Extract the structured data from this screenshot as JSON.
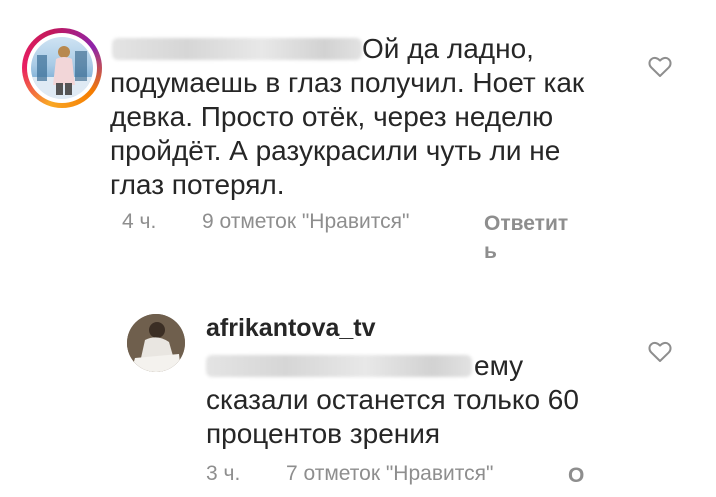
{
  "comments": [
    {
      "username_hidden": true,
      "text_lines": [
        "Ой да ладно,",
        "подумаешь в глаз получил. Ноет как",
        "девка. Просто отёк,  через неделю",
        "пройдёт. А разукрасили чуть ли не",
        "глаз потерял."
      ],
      "time": "4 ч.",
      "likes": "9 отметок \"Нравится\"",
      "reply_line1": "Ответит",
      "reply_line2": "ь"
    },
    {
      "username": "afrikantova_tv",
      "mention_hidden": true,
      "text_lines": [
        "ему",
        "сказали останется только 60",
        "процентов зрения"
      ],
      "time": "3 ч.",
      "likes": "7 отметок \"Нравится\"",
      "reply_partial": "О"
    }
  ],
  "icons": {
    "like": "heart-outline-icon"
  },
  "colors": {
    "text": "#262626",
    "meta": "#8e8e8e",
    "icon": "#8e8e8e"
  }
}
